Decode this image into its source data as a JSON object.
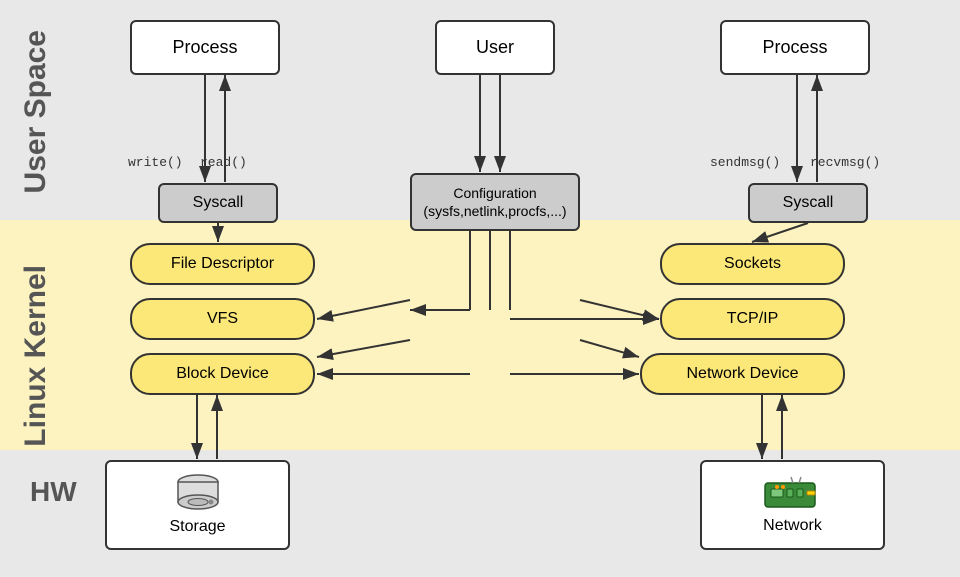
{
  "layers": {
    "user_space": {
      "label": "User\nSpace"
    },
    "kernel": {
      "label": "Linux\nKernel"
    },
    "hw": {
      "label": "HW"
    }
  },
  "boxes": {
    "process_left": {
      "label": "Process"
    },
    "process_right": {
      "label": "Process"
    },
    "user_center": {
      "label": "User"
    },
    "syscall_left": {
      "label": "Syscall"
    },
    "syscall_right": {
      "label": "Syscall"
    },
    "configuration": {
      "label": "Configuration\n(sysfs,netlink,procfs,...)"
    },
    "file_descriptor": {
      "label": "File Descriptor"
    },
    "vfs": {
      "label": "VFS"
    },
    "block_device": {
      "label": "Block Device"
    },
    "sockets": {
      "label": "Sockets"
    },
    "tcp_ip": {
      "label": "TCP/IP"
    },
    "network_device": {
      "label": "Network Device"
    },
    "storage": {
      "label": "Storage"
    },
    "network": {
      "label": "Network"
    }
  },
  "annotations": {
    "write": "write()",
    "read": "read()",
    "sendmsg": "sendmsg()",
    "recvmsg": "recvmsg()"
  },
  "colors": {
    "user_space_bg": "#e8e8e8",
    "kernel_bg": "#fdf3c0",
    "hw_bg": "#e8e8e8",
    "box_kernel_fill": "#fce878",
    "box_white": "#ffffff",
    "box_gray": "#cccccc",
    "border": "#333333"
  }
}
